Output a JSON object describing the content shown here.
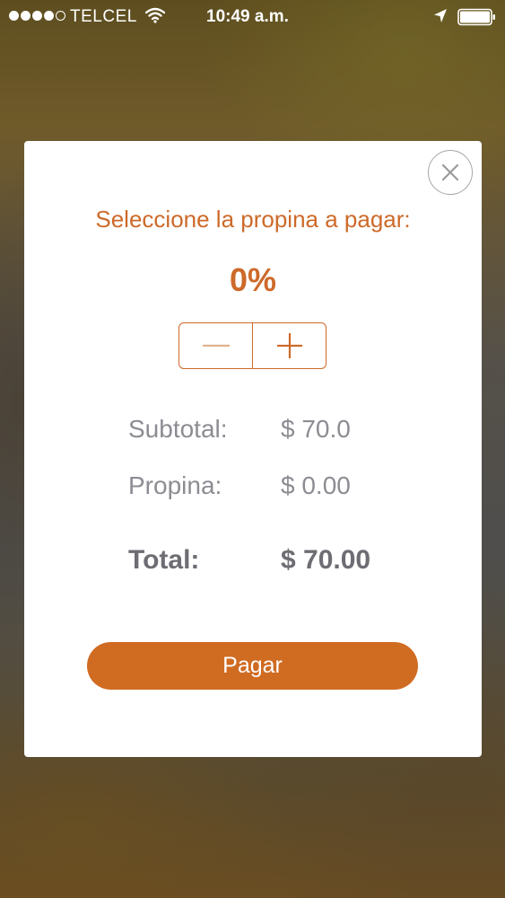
{
  "status_bar": {
    "carrier": "TELCEL",
    "time": "10:49 a.m.",
    "signal_bars_filled": 4,
    "signal_bars_total": 5,
    "icons": [
      "wifi-icon",
      "location-arrow-icon",
      "battery-icon"
    ],
    "battery_level": 0.9
  },
  "modal": {
    "close_icon": "close-icon",
    "prompt": "Seleccione la propina a pagar:",
    "percent": "0%",
    "stepper": {
      "decrement_icon": "minus-icon",
      "increment_icon": "plus-icon"
    },
    "subtotal": {
      "label": "Subtotal:",
      "value": "$ 70.0"
    },
    "tip": {
      "label": "Propina:",
      "value": "$ 0.00"
    },
    "total": {
      "label": "Total:",
      "value": "$ 70.00"
    },
    "pay_label": "Pagar"
  },
  "colors": {
    "accent": "#cd6a2a",
    "button": "#d06b22",
    "text_gray": "#8c8c93",
    "text_dark_gray": "#6d6d73",
    "modal_bg": "#ffffff"
  }
}
